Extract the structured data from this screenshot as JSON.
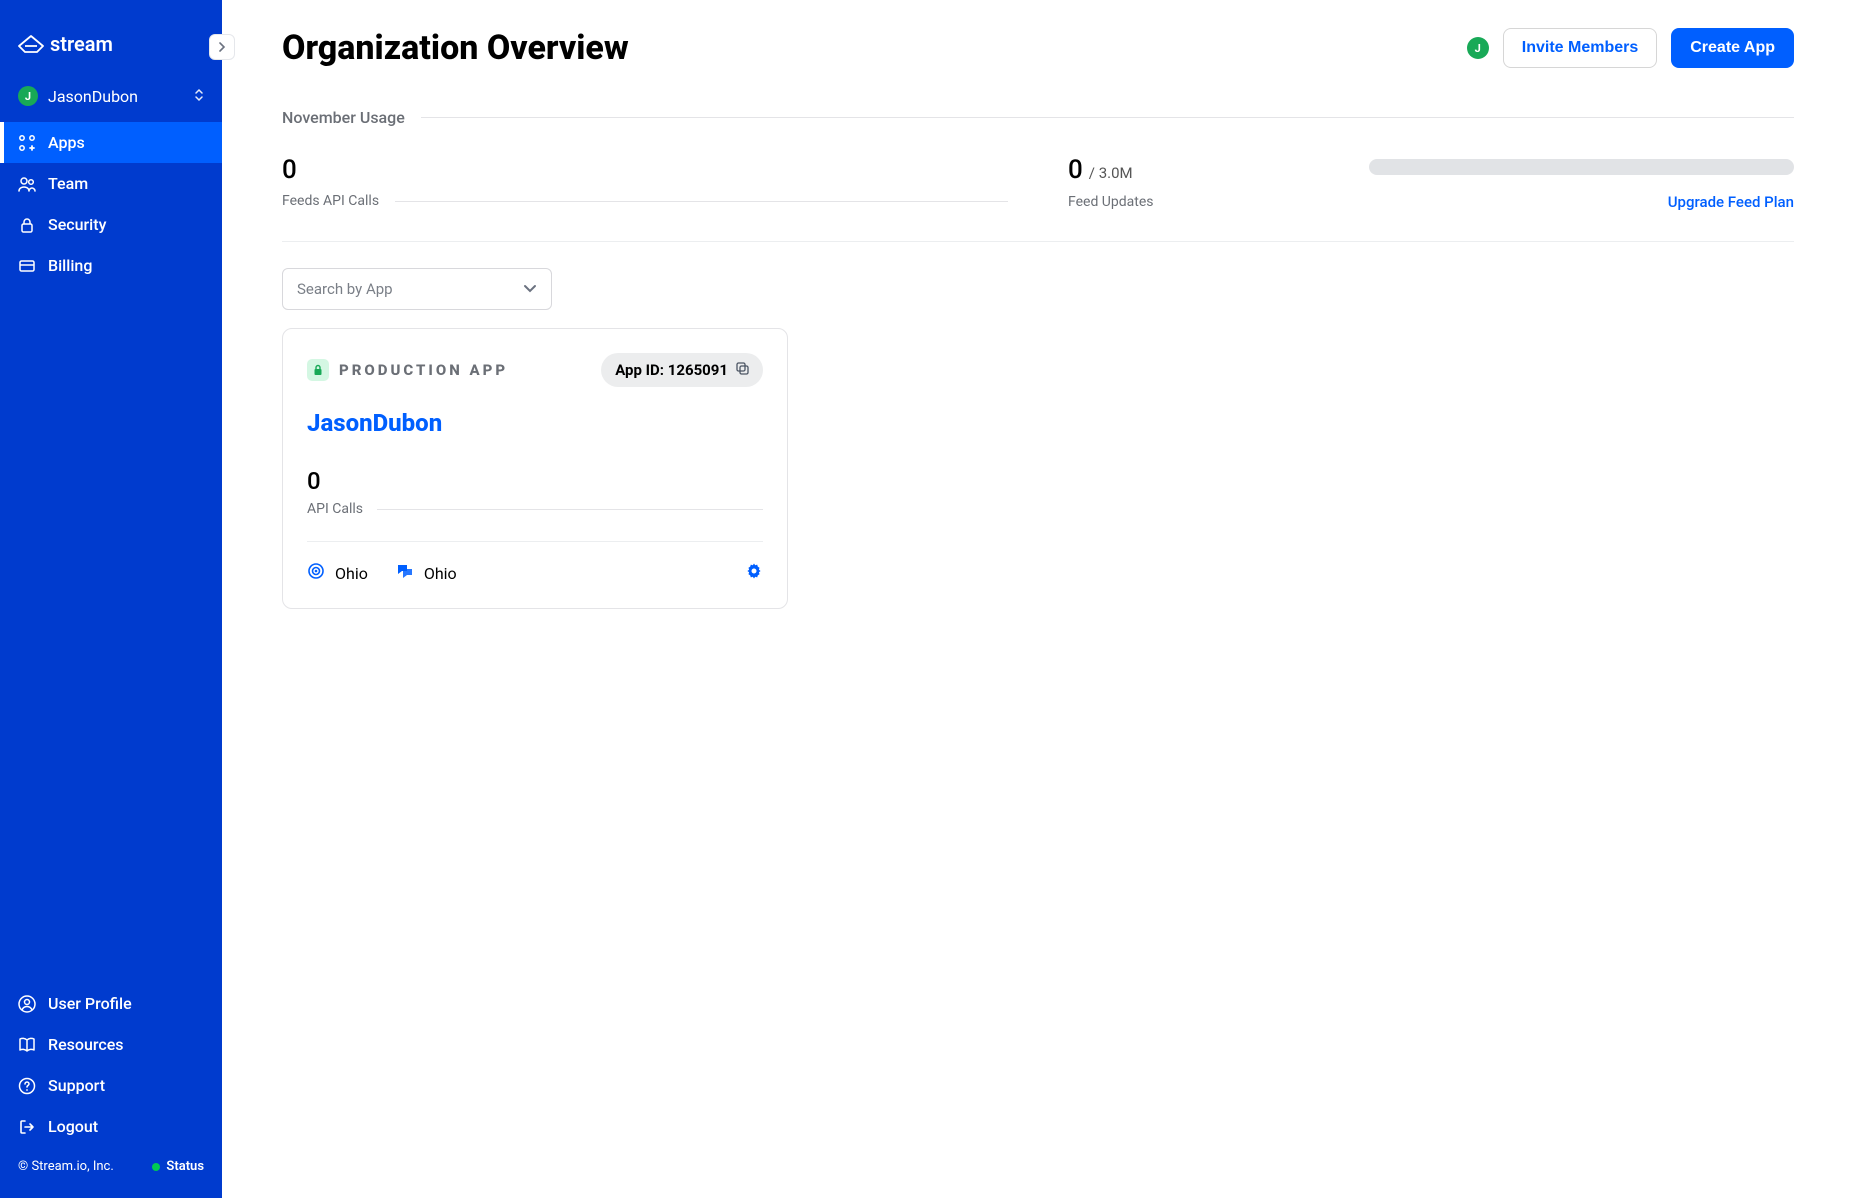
{
  "brand": "stream",
  "org": {
    "avatar_letter": "J",
    "name": "JasonDubon"
  },
  "sidebar": {
    "items": [
      {
        "label": "Apps"
      },
      {
        "label": "Team"
      },
      {
        "label": "Security"
      },
      {
        "label": "Billing"
      }
    ],
    "bottom": [
      {
        "label": "User Profile"
      },
      {
        "label": "Resources"
      },
      {
        "label": "Support"
      },
      {
        "label": "Logout"
      }
    ],
    "copyright": "© Stream.io, Inc.",
    "status_label": "Status"
  },
  "header": {
    "title": "Organization Overview",
    "user_letter": "J",
    "invite_label": "Invite Members",
    "create_label": "Create App"
  },
  "usage": {
    "section_label": "November Usage",
    "feeds_api_value": "0",
    "feeds_api_label": "Feeds API Calls",
    "feed_updates_value": "0",
    "feed_updates_limit": "/ 3.0M",
    "feed_updates_label": "Feed Updates",
    "upgrade_link": "Upgrade Feed Plan"
  },
  "search": {
    "placeholder": "Search by App"
  },
  "app": {
    "type_label": "PRODUCTION APP",
    "id_label": "App ID: 1265091",
    "name": "JasonDubon",
    "metric_value": "0",
    "metric_label": "API Calls",
    "region1": "Ohio",
    "region2": "Ohio"
  }
}
